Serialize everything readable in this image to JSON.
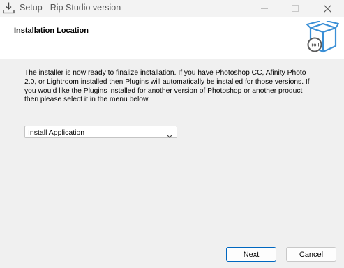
{
  "window": {
    "title": "Setup - Rip Studio version",
    "icons": {
      "app": "download-tray-icon",
      "minimize": "minimize-icon",
      "maximize": "maximize-icon",
      "close": "close-icon"
    }
  },
  "header": {
    "title": "Installation Location",
    "icon": "software-box-icon",
    "box_label": "iroll"
  },
  "main": {
    "description": "The installer is now ready to finalize installation. If you have Photoshop CC, Afinity Photo 2.0, or Lightroom installed then Plugins will automatically be installed for those versions. If you would like the Plugins installed for another version of Photoshop or another product then please select it in the menu below.",
    "dropdown": {
      "selected": "Install Application",
      "icon": "chevron-down-icon"
    }
  },
  "footer": {
    "next_label": "Next",
    "cancel_label": "Cancel"
  },
  "colors": {
    "accent": "#0067c0",
    "dialog_bg": "#f0f0f0",
    "header_bg": "#ffffff",
    "box_blue": "#3a8fd6"
  }
}
